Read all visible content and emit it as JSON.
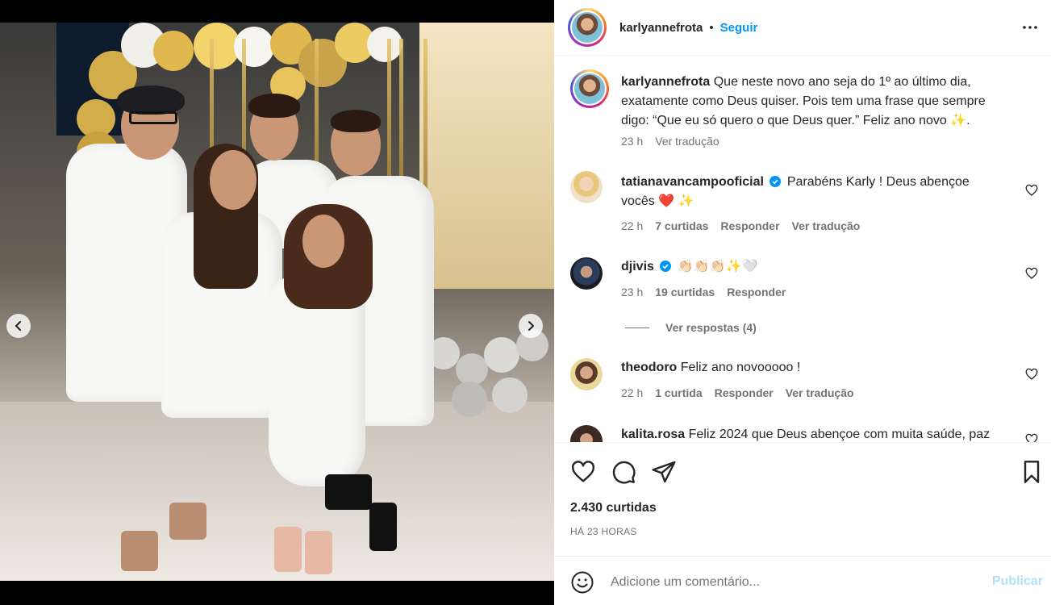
{
  "post": {
    "username": "karlyannefrota",
    "follow_label": "Seguir",
    "separator": "•",
    "caption_username": "karlyannefrota",
    "caption_text": "Que neste novo ano seja do 1º ao último dia, exatamente como Deus quiser. Pois tem uma frase que sempre digo: “Que eu só quero o que Deus quer.” Feliz ano novo ✨.",
    "caption_time": "23 h",
    "caption_translate": "Ver tradução"
  },
  "comments": [
    {
      "username": "tatianavancampooficial",
      "verified": true,
      "text": "Parabéns Karly ! Deus abençoe vocês ❤️ ✨",
      "time": "22 h",
      "likes": "7 curtidas",
      "reply": "Responder",
      "translate": "Ver tradução"
    },
    {
      "username": "djivis",
      "verified": true,
      "text": "👏🏻👏🏻👏🏻✨🤍",
      "time": "23 h",
      "likes": "19 curtidas",
      "reply": "Responder",
      "view_replies": "Ver respostas (4)"
    },
    {
      "username": "theodoro",
      "verified": false,
      "text": "Feliz ano novooooo !",
      "time": "22 h",
      "likes": "1 curtida",
      "reply": "Responder",
      "translate": "Ver tradução"
    },
    {
      "username": "kalita.rosa",
      "verified": false,
      "text": "Feliz 2024 que Deus abençoe com muita saúde, paz"
    }
  ],
  "actions": {
    "like_count": "2.430 curtidas",
    "posted_ago": "HÁ 23 HORAS"
  },
  "add_comment": {
    "placeholder": "Adicione um comentário...",
    "publish_label": "Publicar"
  },
  "carousel": {
    "total": 9,
    "active_index": 1
  },
  "icons": {
    "more": "more-horizontal-icon",
    "like": "heart-icon",
    "comment": "comment-icon",
    "share": "send-icon",
    "save": "bookmark-icon",
    "emoji": "smiley-icon",
    "verified": "verified-badge-icon",
    "prev": "chevron-left-icon",
    "next": "chevron-right-icon"
  },
  "colors": {
    "link_blue": "#0095f6",
    "publish_disabled": "#b2dffc",
    "muted": "#737373",
    "text": "#262626"
  }
}
